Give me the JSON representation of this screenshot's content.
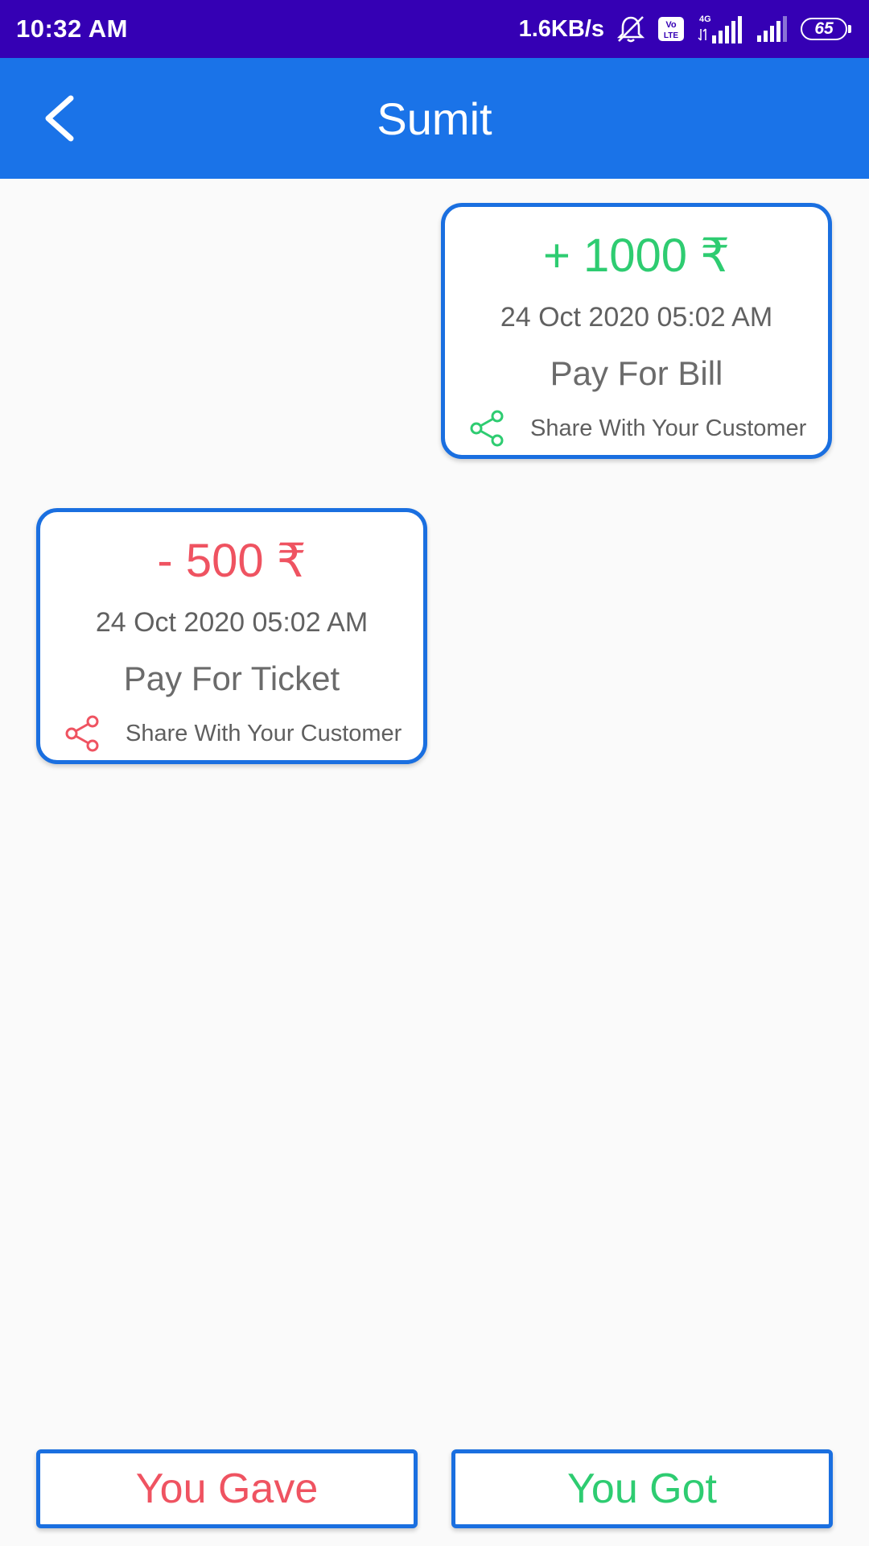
{
  "status_bar": {
    "time": "10:32 AM",
    "net_speed": "1.6KB/s",
    "network_type": "4G",
    "volte_label": "Vo LTE",
    "battery": "65",
    "icons": [
      "mute-alarm-icon",
      "volte-icon",
      "signal-icon",
      "signal-icon",
      "battery-icon"
    ]
  },
  "app_bar": {
    "title": "Sumit",
    "back_icon": "chevron-left-icon"
  },
  "transactions": [
    {
      "amount": "+ 1000 ₹",
      "date": "24 Oct 2020 05:02 AM",
      "note": "Pay For Bill",
      "share_label": "Share With Your Customer",
      "color": "#2ecc71",
      "type": "got"
    },
    {
      "amount": "- 500 ₹",
      "date": "24 Oct 2020 05:02 AM",
      "note": "Pay For Ticket",
      "share_label": "Share With Your Customer",
      "color": "#ef5361",
      "type": "gave"
    }
  ],
  "actions": {
    "gave_label": "You Gave",
    "got_label": "You Got"
  },
  "colors": {
    "status_bar": "#3500b4",
    "app_bar": "#1a73e8",
    "card_border": "#1a6fe0",
    "positive": "#2ecc71",
    "negative": "#ef5361"
  }
}
